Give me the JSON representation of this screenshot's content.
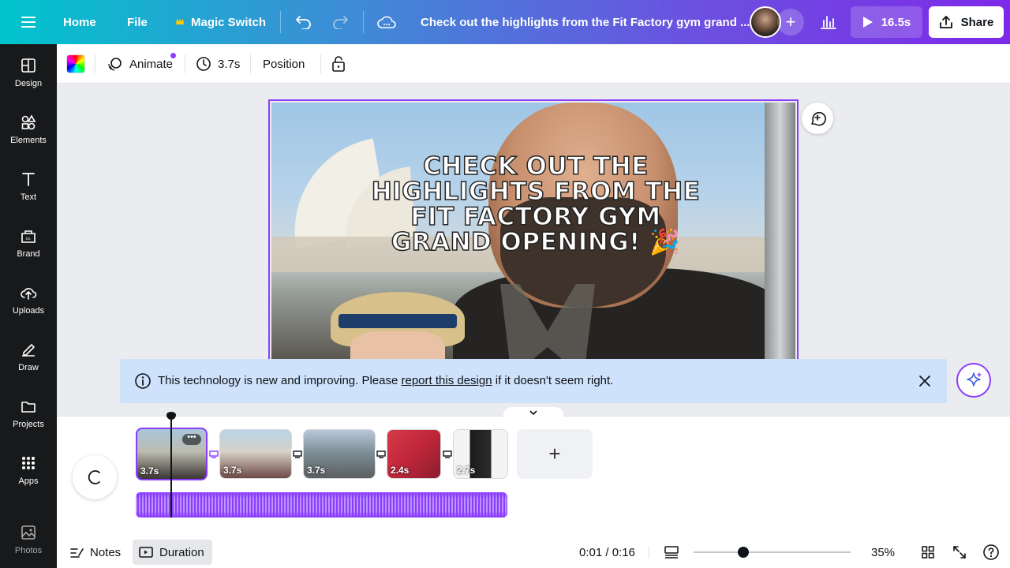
{
  "topbar": {
    "home": "Home",
    "file": "File",
    "magic_switch": "Magic Switch",
    "title": "Check out the highlights from the Fit Factory gym grand ...",
    "play_duration": "16.5s",
    "share": "Share"
  },
  "sidebar": {
    "items": [
      {
        "label": "Design",
        "icon": "design-icon"
      },
      {
        "label": "Elements",
        "icon": "elements-icon"
      },
      {
        "label": "Text",
        "icon": "text-icon"
      },
      {
        "label": "Brand",
        "icon": "brand-icon"
      },
      {
        "label": "Uploads",
        "icon": "uploads-icon"
      },
      {
        "label": "Draw",
        "icon": "draw-icon"
      },
      {
        "label": "Projects",
        "icon": "projects-icon"
      },
      {
        "label": "Apps",
        "icon": "apps-icon"
      },
      {
        "label": "Photos",
        "icon": "photos-icon"
      }
    ]
  },
  "toolbar": {
    "animate": "Animate",
    "duration": "3.7s",
    "position": "Position"
  },
  "canvas": {
    "headline": "CHECK OUT THE HIGHLIGHTS FROM THE FIT FACTORY GYM GRAND OPENING! 🎉"
  },
  "notice": {
    "text_before": "This technology is new and improving. Please ",
    "link": "report this design",
    "text_after": " if it doesn't seem right."
  },
  "timeline": {
    "clips": [
      {
        "duration": "3.7s",
        "selected": true
      },
      {
        "duration": "3.7s",
        "selected": false
      },
      {
        "duration": "3.7s",
        "selected": false
      },
      {
        "duration": "2.4s",
        "selected": false
      },
      {
        "duration": "2.7s",
        "selected": false
      }
    ],
    "clip_more": "•••"
  },
  "bottombar": {
    "notes": "Notes",
    "duration": "Duration",
    "time": "0:01 / 0:16",
    "zoom": "35%"
  },
  "colors": {
    "accent": "#8b3dff",
    "notice_bg": "#cfe2fb"
  }
}
